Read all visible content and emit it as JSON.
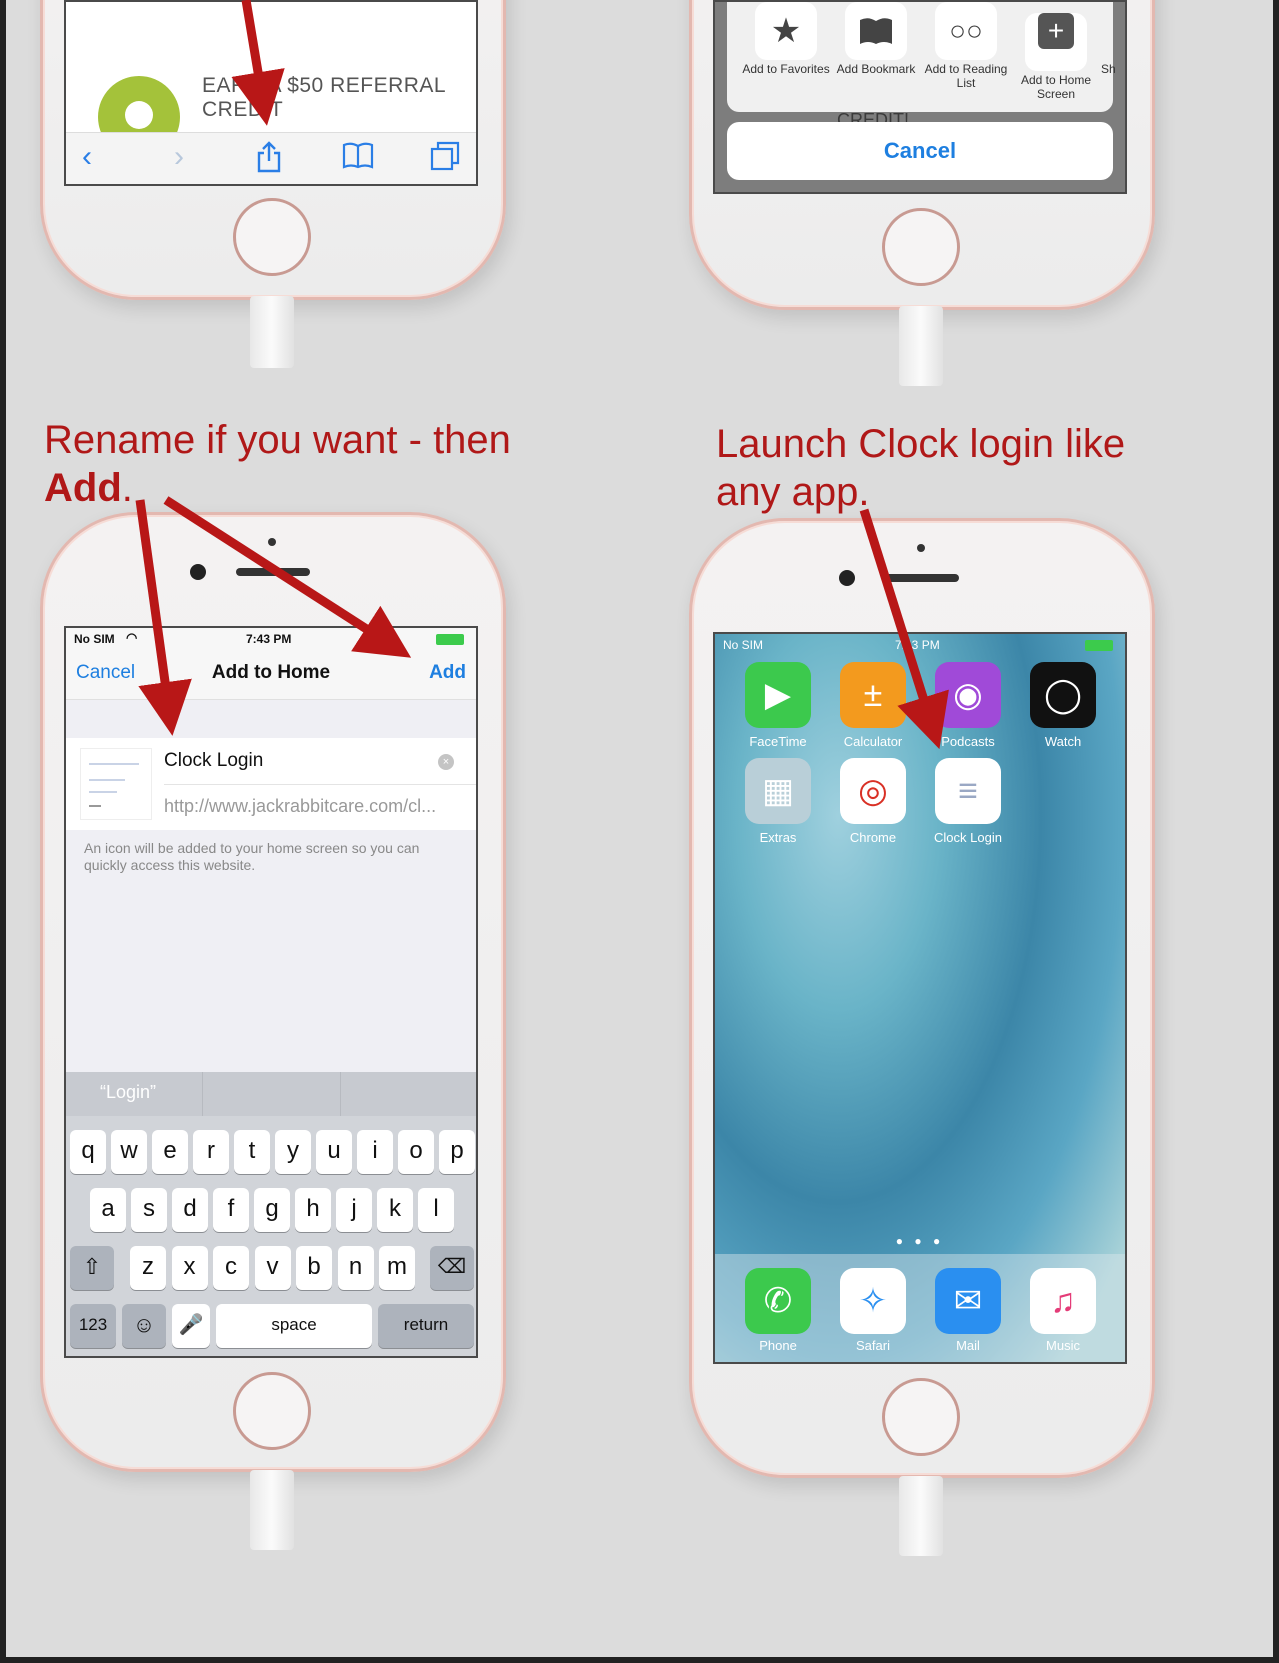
{
  "captions": {
    "step3_line1": "Rename if you want - then",
    "step3_add": "Add",
    "step3_period": ".",
    "step4_line1": "Launch Clock login like",
    "step4_line2": "any app."
  },
  "safari_page": {
    "ad_line1": "EARN A $50 REFERRAL",
    "ad_line2": "CREDIT",
    "toolbar": {
      "back_icon": "back-chevron-icon",
      "forward_icon": "forward-chevron-icon",
      "share_icon": "share-icon",
      "bookmarks_icon": "bookmarks-icon",
      "tabs_icon": "tabs-icon"
    }
  },
  "share_sheet": {
    "actions": [
      {
        "label": "Add to Favorites",
        "icon": "star-icon"
      },
      {
        "label": "Add Bookmark",
        "icon": "book-icon"
      },
      {
        "label": "Add to Reading List",
        "icon": "glasses-icon"
      },
      {
        "label": "Add to Home Screen",
        "icon": "plus-icon"
      },
      {
        "label": "Sh",
        "icon": "partial-icon"
      }
    ],
    "behind_text": "CREDIT!",
    "cancel": "Cancel"
  },
  "add_to_home": {
    "status": {
      "carrier": "No SIM",
      "time": "7:43 PM"
    },
    "nav": {
      "cancel": "Cancel",
      "title": "Add to Home",
      "add": "Add"
    },
    "name_value": "Clock Login",
    "url_value": "http://www.jackrabbitcare.com/cl...",
    "hint": "An icon will be added to your home screen so you can quickly access this website.",
    "suggestion": "“Login”",
    "keyboard": {
      "row1": [
        "q",
        "w",
        "e",
        "r",
        "t",
        "y",
        "u",
        "i",
        "o",
        "p"
      ],
      "row2": [
        "a",
        "s",
        "d",
        "f",
        "g",
        "h",
        "j",
        "k",
        "l"
      ],
      "row3": [
        "z",
        "x",
        "c",
        "v",
        "b",
        "n",
        "m"
      ],
      "numbers": "123",
      "space": "space",
      "return": "return"
    }
  },
  "home_screen": {
    "status": {
      "carrier": "No SIM",
      "time": "7:43 PM"
    },
    "apps_row1": [
      {
        "label": "FaceTime",
        "icon": "facetime-icon",
        "color": "#3cc94d"
      },
      {
        "label": "Calculator",
        "icon": "calculator-icon",
        "color": "#f39a1e"
      },
      {
        "label": "Podcasts",
        "icon": "podcasts-icon",
        "color": "#a04ad8"
      },
      {
        "label": "Watch",
        "icon": "watch-icon",
        "color": "#111111"
      }
    ],
    "apps_row2": [
      {
        "label": "Extras",
        "icon": "folder-icon",
        "color": "#b9cfd8"
      },
      {
        "label": "Chrome",
        "icon": "chrome-icon",
        "color": "#ffffff"
      },
      {
        "label": "Clock Login",
        "icon": "webclip-icon",
        "color": "#ffffff"
      }
    ],
    "dock": [
      {
        "label": "Phone",
        "icon": "phone-icon",
        "color": "#3cc94d"
      },
      {
        "label": "Safari",
        "icon": "safari-icon",
        "color": "#ffffff"
      },
      {
        "label": "Mail",
        "icon": "mail-icon",
        "color": "#2a8ff0"
      },
      {
        "label": "Music",
        "icon": "music-icon",
        "color": "#ffffff"
      }
    ]
  },
  "colors": {
    "annotation_red": "#b01818",
    "ios_blue": "#1e7fe0",
    "phone_rose": "#e3b8b0"
  }
}
